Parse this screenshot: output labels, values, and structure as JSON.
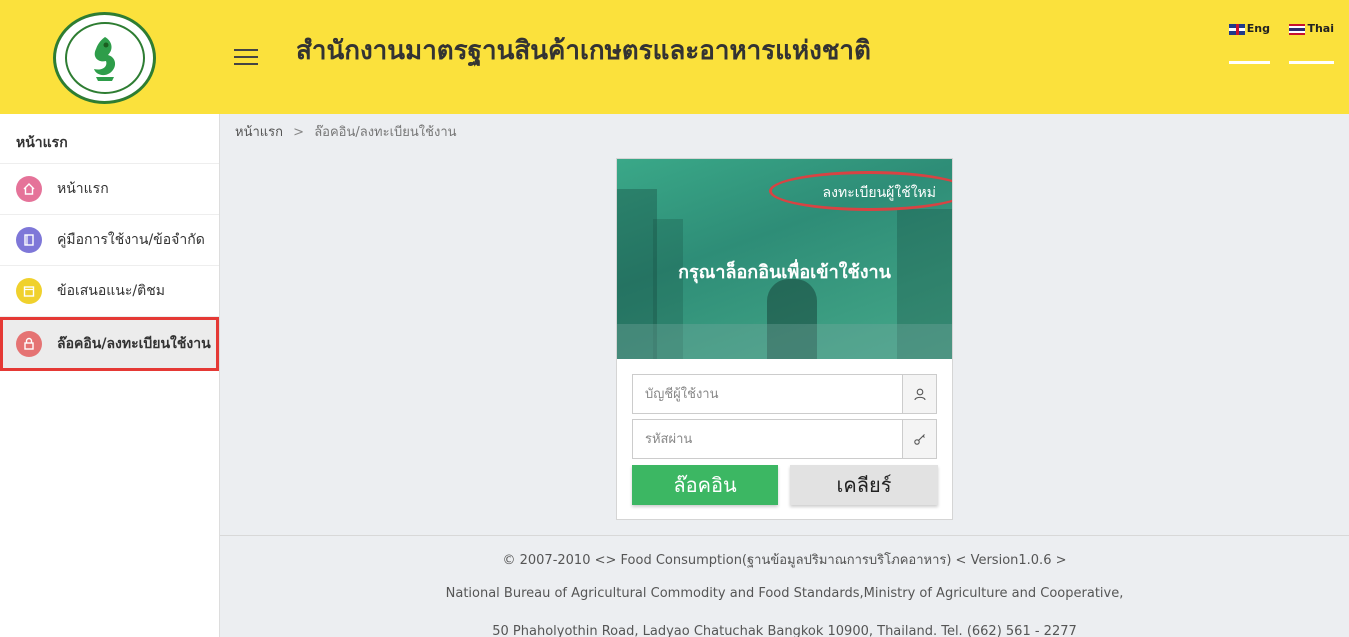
{
  "header": {
    "title": "สำนักงานมาตรฐานสินค้าเกษตรและอาหารแห่งชาติ",
    "lang_en": "Eng",
    "lang_th": "Thai",
    "accent_color": "#fbe13c"
  },
  "sidebar": {
    "heading": "หน้าแรก",
    "items": [
      {
        "label": "หน้าแรก",
        "icon": "home-icon",
        "color": "#e57399"
      },
      {
        "label": "คู่มือการใช้งาน/ข้อจำกัด",
        "icon": "book-icon",
        "color": "#7e77d8"
      },
      {
        "label": "ข้อเสนอแนะ/ติชม",
        "icon": "calendar-icon",
        "color": "#f0d12d"
      },
      {
        "label": "ล๊อคอิน/ลงทะเบียนใช้งาน",
        "icon": "lock-icon",
        "color": "#e57373"
      }
    ]
  },
  "breadcrumb": {
    "home": "หน้าแรก",
    "separator": ">",
    "current": "ล๊อคอิน/ลงทะเบียนใช้งาน"
  },
  "login": {
    "register_link": "ลงทะเบียนผู้ใช้ใหม่",
    "title": "กรุณาล็อกอินเพื่อเข้าใช้งาน",
    "username_placeholder": "บัญชีผู้ใช้งาน",
    "password_placeholder": "รหัสผ่าน",
    "login_button": "ล๊อคอิน",
    "clear_button": "เคลียร์"
  },
  "footer": {
    "line1": "© 2007-2010 <> Food Consumption(ฐานข้อมูลปริมาณการบริโภคอาหาร) < Version1.0.6 >",
    "line2": "National Bureau of Agricultural Commodity and Food Standards,Ministry of Agriculture and Cooperative,",
    "line3": "50 Phaholyothin Road, Ladyao Chatuchak Bangkok 10900, Thailand. Tel. (662) 561 - 2277"
  }
}
